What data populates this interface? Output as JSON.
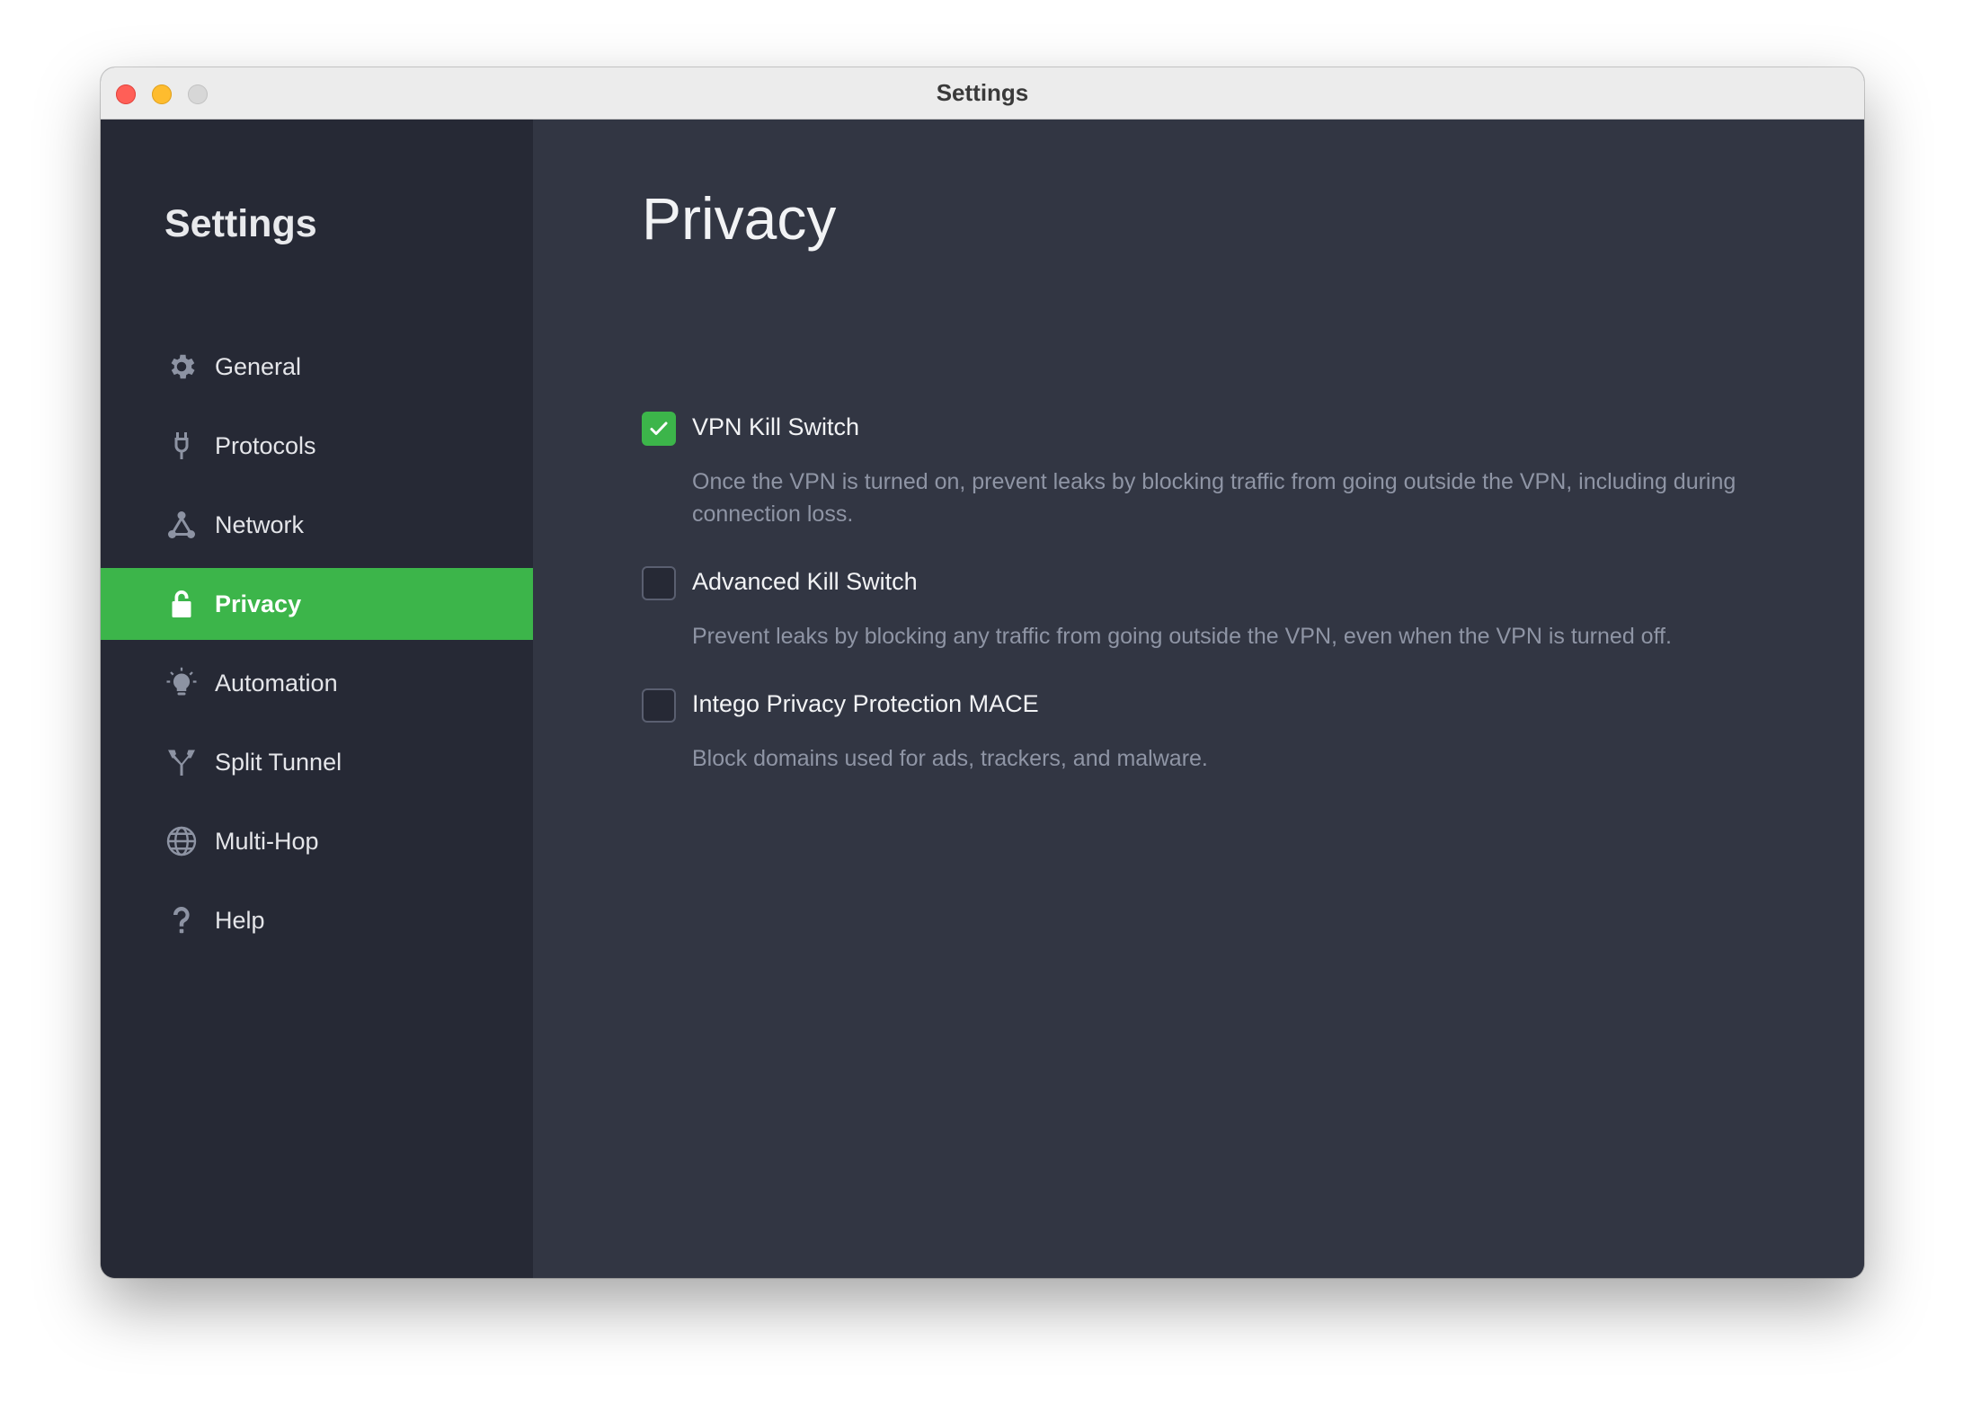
{
  "window": {
    "title": "Settings"
  },
  "sidebar": {
    "title": "Settings",
    "items": [
      {
        "label": "General",
        "icon": "gear-icon",
        "active": false
      },
      {
        "label": "Protocols",
        "icon": "plug-icon",
        "active": false
      },
      {
        "label": "Network",
        "icon": "network-icon",
        "active": false
      },
      {
        "label": "Privacy",
        "icon": "lock-icon",
        "active": true
      },
      {
        "label": "Automation",
        "icon": "lightbulb-icon",
        "active": false
      },
      {
        "label": "Split Tunnel",
        "icon": "split-tunnel-icon",
        "active": false
      },
      {
        "label": "Multi-Hop",
        "icon": "globe-icon",
        "active": false
      },
      {
        "label": "Help",
        "icon": "question-icon",
        "active": false
      }
    ]
  },
  "main": {
    "title": "Privacy",
    "options": [
      {
        "label": "VPN Kill Switch",
        "checked": true,
        "description": "Once the VPN is turned on, prevent leaks by blocking traffic from going outside the VPN, including during connection loss."
      },
      {
        "label": "Advanced Kill Switch",
        "checked": false,
        "description": "Prevent leaks by blocking any traffic from going outside the VPN, even when the VPN is turned off."
      },
      {
        "label": "Intego Privacy Protection MACE",
        "checked": false,
        "description": "Block domains used for ads, trackers, and malware."
      }
    ]
  },
  "colors": {
    "accent": "#3cb54a",
    "sidebar_bg": "#262935",
    "main_bg": "#323643",
    "muted_text": "#8f95a5"
  }
}
